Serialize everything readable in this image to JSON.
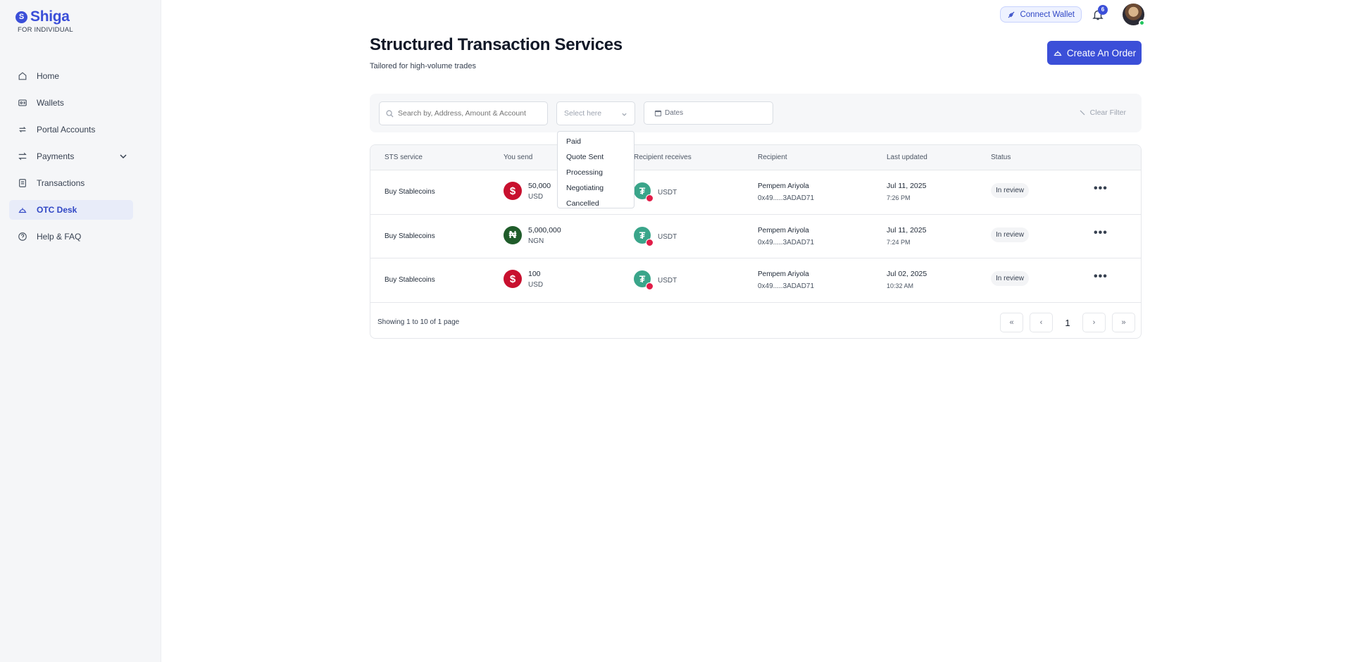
{
  "brand": {
    "name": "Shiga",
    "subtitle": "FOR INDIVIDUAL"
  },
  "sidebar": {
    "items": [
      {
        "label": "Home",
        "icon": "home-icon"
      },
      {
        "label": "Wallets",
        "icon": "wallet-icon"
      },
      {
        "label": "Portal Accounts",
        "icon": "portal-icon"
      },
      {
        "label": "Payments",
        "icon": "payments-icon"
      },
      {
        "label": "Transactions",
        "icon": "transactions-icon"
      },
      {
        "label": "OTC Desk",
        "icon": "otc-icon"
      },
      {
        "label": "Help & FAQ",
        "icon": "help-icon"
      }
    ]
  },
  "header": {
    "connect_wallet": "Connect Wallet",
    "notification_count": "6"
  },
  "page": {
    "title": "Structured Transaction Services",
    "subtitle": "Tailored for high-volume trades",
    "create_button": "Create An Order"
  },
  "filters": {
    "search_placeholder": "Search by, Address, Amount & Account",
    "select_placeholder": "Select here",
    "dates_label": "Dates",
    "clear_label": "Clear Filter",
    "options": [
      "Paid",
      "Quote Sent",
      "Processing",
      "Negotiating",
      "Cancelled"
    ]
  },
  "table": {
    "headers": [
      "STS service",
      "You send",
      "Recipient receives",
      "Recipient",
      "Last updated",
      "Status"
    ],
    "rows": [
      {
        "service": "Buy Stablecoins",
        "send_amount": "50,000",
        "send_currency": "USD",
        "send_symbol": "$",
        "receive": "USDT",
        "recipient_name": "Pempem Ariyola",
        "recipient_address": "0x49.....3ADAD71",
        "date": "Jul 11, 2025",
        "time": "7:26 PM",
        "status": "In review"
      },
      {
        "service": "Buy Stablecoins",
        "send_amount": "5,000,000",
        "send_currency": "NGN",
        "send_symbol": "₦",
        "receive": "USDT",
        "recipient_name": "Pempem Ariyola",
        "recipient_address": "0x49.....3ADAD71",
        "date": "Jul 11, 2025",
        "time": "7:24 PM",
        "status": "In review"
      },
      {
        "service": "Buy Stablecoins",
        "send_amount": "100",
        "send_currency": "USD",
        "send_symbol": "$",
        "receive": "USDT",
        "recipient_name": "Pempem Ariyola",
        "recipient_address": "0x49.....3ADAD71",
        "date": "Jul 02, 2025",
        "time": "10:32 AM",
        "status": "In review"
      }
    ],
    "footer": "Showing 1 to 10 of 1 page",
    "pagination": {
      "first": "«",
      "prev": "‹",
      "current": "1",
      "next": "›",
      "last": "»"
    }
  },
  "colors": {
    "accent": "#3b4fd8",
    "usd": "#c8102e",
    "ngn": "#1f5c2a",
    "usdt": "#3aa58a"
  }
}
